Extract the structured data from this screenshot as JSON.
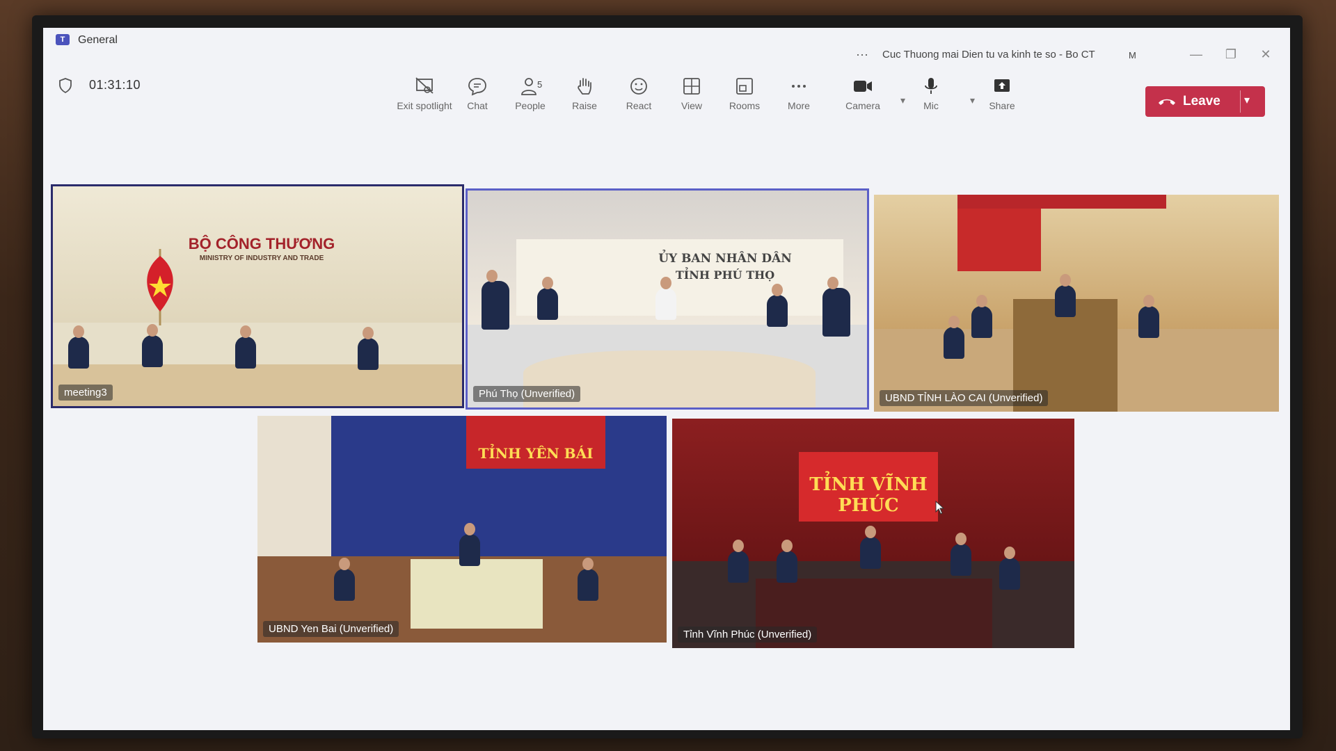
{
  "window": {
    "title": "General",
    "meeting_name": "Cuc Thuong mai Dien tu va kinh te so - Bo CT",
    "user_initial": "M",
    "controls": {
      "minimize": "—",
      "restore": "❐",
      "close": "✕"
    }
  },
  "meeting": {
    "elapsed": "01:31:10"
  },
  "toolbar": {
    "exit_spotlight": "Exit spotlight",
    "chat": "Chat",
    "people": "People",
    "people_count": "5",
    "raise": "Raise",
    "react": "React",
    "view": "View",
    "rooms": "Rooms",
    "more": "More",
    "camera": "Camera",
    "mic": "Mic",
    "share": "Share",
    "leave": "Leave"
  },
  "tiles": [
    {
      "name": "meeting3",
      "banner": "BỘ CÔNG THƯƠNG",
      "banner_sub": "MINISTRY OF INDUSTRY AND TRADE"
    },
    {
      "name": "Phú Thọ (Unverified)",
      "banner": "ỦY BAN NHÂN DÂN",
      "banner_sub": "TỈNH PHÚ THỌ"
    },
    {
      "name": "UBND TỈNH LÀO CAI (Unverified)"
    },
    {
      "name": "UBND Yen Bai (Unverified)",
      "banner": "TỈNH YÊN BÁI"
    },
    {
      "name": "Tỉnh Vĩnh Phúc (Unverified)",
      "banner": "TỈNH VĨNH PHÚC"
    }
  ],
  "colors": {
    "accent": "#5b5fc7",
    "leave": "#c4314b",
    "background": "#f2f3f7"
  }
}
